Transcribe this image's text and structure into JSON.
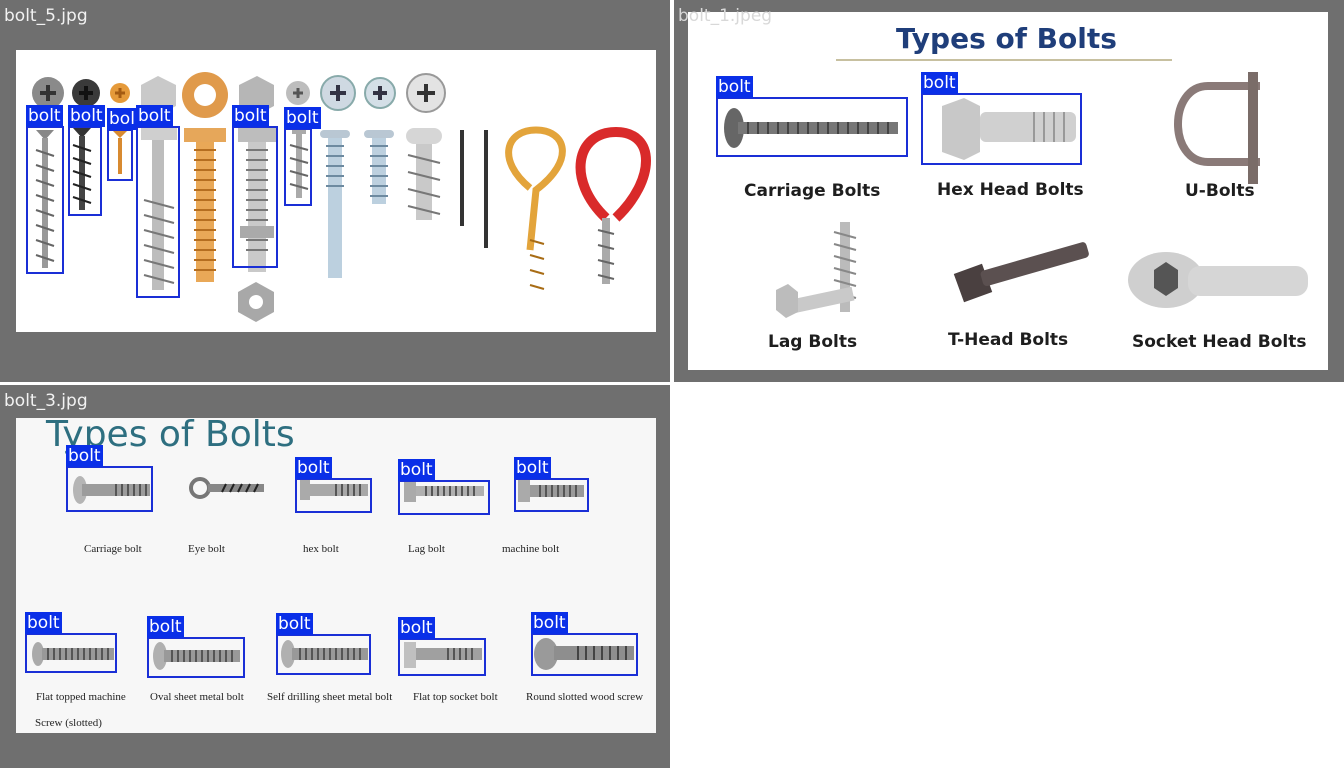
{
  "tiles": [
    {
      "filename": "bolt_5.jpg",
      "detections": [
        {
          "label": "bolt"
        },
        {
          "label": "bolt"
        },
        {
          "label": "bol"
        },
        {
          "label": "bolt"
        },
        {
          "label": "bolt"
        },
        {
          "label": "bolt"
        }
      ]
    },
    {
      "filename": "bolt_1.jpeg",
      "title": "Types of Bolts",
      "captions": [
        "Carriage Bolts",
        "Hex Head Bolts",
        "U-Bolts",
        "Lag Bolts",
        "T-Head Bolts",
        "Socket Head Bolts"
      ],
      "detections": [
        {
          "label": "bolt"
        },
        {
          "label": "bolt"
        }
      ]
    },
    {
      "filename": "bolt_3.jpg",
      "title": "Types of Bolts",
      "captions": [
        "Carriage bolt",
        "Eye bolt",
        "hex bolt",
        "Lag bolt",
        "machine bolt",
        "Flat topped machine",
        "Screw (slotted)",
        "Oval sheet metal bolt",
        "Self drilling sheet metal bolt",
        "Flat top socket bolt",
        "Round slotted wood screw"
      ],
      "detections": [
        {
          "label": "bolt"
        },
        {
          "label": "bolt"
        },
        {
          "label": "bolt"
        },
        {
          "label": "bolt"
        },
        {
          "label": "bolt"
        },
        {
          "label": "bolt"
        },
        {
          "label": "bolt"
        },
        {
          "label": "bolt"
        },
        {
          "label": "bolt"
        }
      ]
    }
  ],
  "colors": {
    "tile_bg": "#6f6f6f",
    "box": "#1a2fd6",
    "label_bg": "#0a2fe8",
    "title_blue": "#1f3e7a",
    "title_teal": "#2e6f80"
  }
}
